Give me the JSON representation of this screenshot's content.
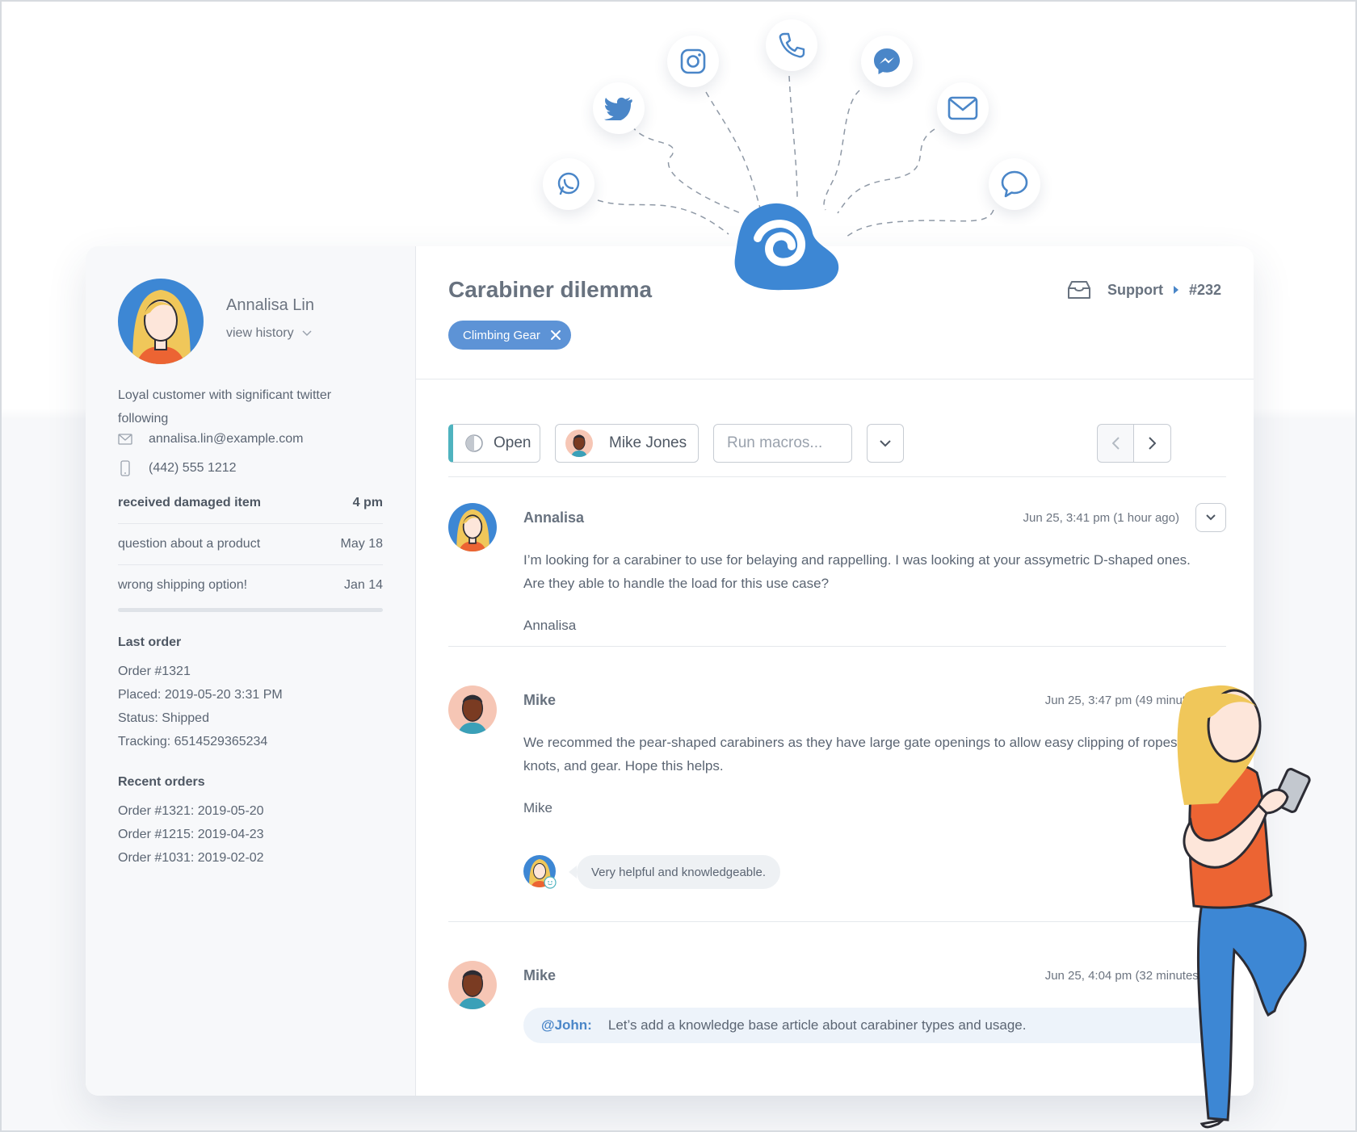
{
  "customer": {
    "name": "Annalisa Lin",
    "view_history": "view history",
    "description": "Loyal customer with significant twitter following",
    "email": "annalisa.lin@example.com",
    "phone": "(442) 555 1212"
  },
  "history": [
    {
      "subject": "received damaged item",
      "time": "4 pm"
    },
    {
      "subject": "question about a product",
      "time": "May 18"
    },
    {
      "subject": "wrong shipping option!",
      "time": "Jan 14"
    }
  ],
  "last_order": {
    "title": "Last order",
    "lines": [
      "Order #1321",
      "Placed: 2019-05-20 3:31 PM",
      "Status: Shipped",
      "Tracking: 6514529365234"
    ]
  },
  "recent_orders": {
    "title": "Recent orders",
    "lines": [
      "Order #1321: 2019-05-20",
      "Order #1215: 2019-04-23",
      "Order #1031: 2019-02-02"
    ]
  },
  "ticket": {
    "title": "Carabiner dilemma",
    "breadcrumb_team": "Support",
    "breadcrumb_id": "#232",
    "tag": "Climbing Gear"
  },
  "toolbar": {
    "status": "Open",
    "assignee": "Mike Jones",
    "macros_placeholder": "Run macros..."
  },
  "messages": [
    {
      "author": "Annalisa",
      "time": "Jun 25, 3:41 pm (1 hour ago)",
      "body": "I’m looking for a carabiner to use for belaying and rappelling. I was looking at your assymetric D-shaped ones. Are they able to handle the load for this use case?",
      "signature": "Annalisa"
    },
    {
      "author": "Mike",
      "time": "Jun 25, 3:47 pm (49 minutes ago)",
      "body": "We recommed the pear-shaped carabiners as they have large gate openings to allow easy clipping of ropes, knots, and gear. Hope this helps.",
      "signature": "Mike",
      "rating_comment": "Very helpful and knowledgeable."
    },
    {
      "author": "Mike",
      "time": "Jun 25, 4:04 pm (32 minutes ago)",
      "mention": "@John:",
      "note": "Let’s add a knowledge base article about carabiner types and usage."
    }
  ],
  "channels": [
    "whatsapp-icon",
    "twitter-icon",
    "instagram-icon",
    "phone-icon",
    "messenger-icon",
    "email-icon",
    "chat-icon"
  ],
  "colors": {
    "brand": "#3d87d4",
    "accent": "#5d93d6",
    "status": "#4fb3bf"
  }
}
